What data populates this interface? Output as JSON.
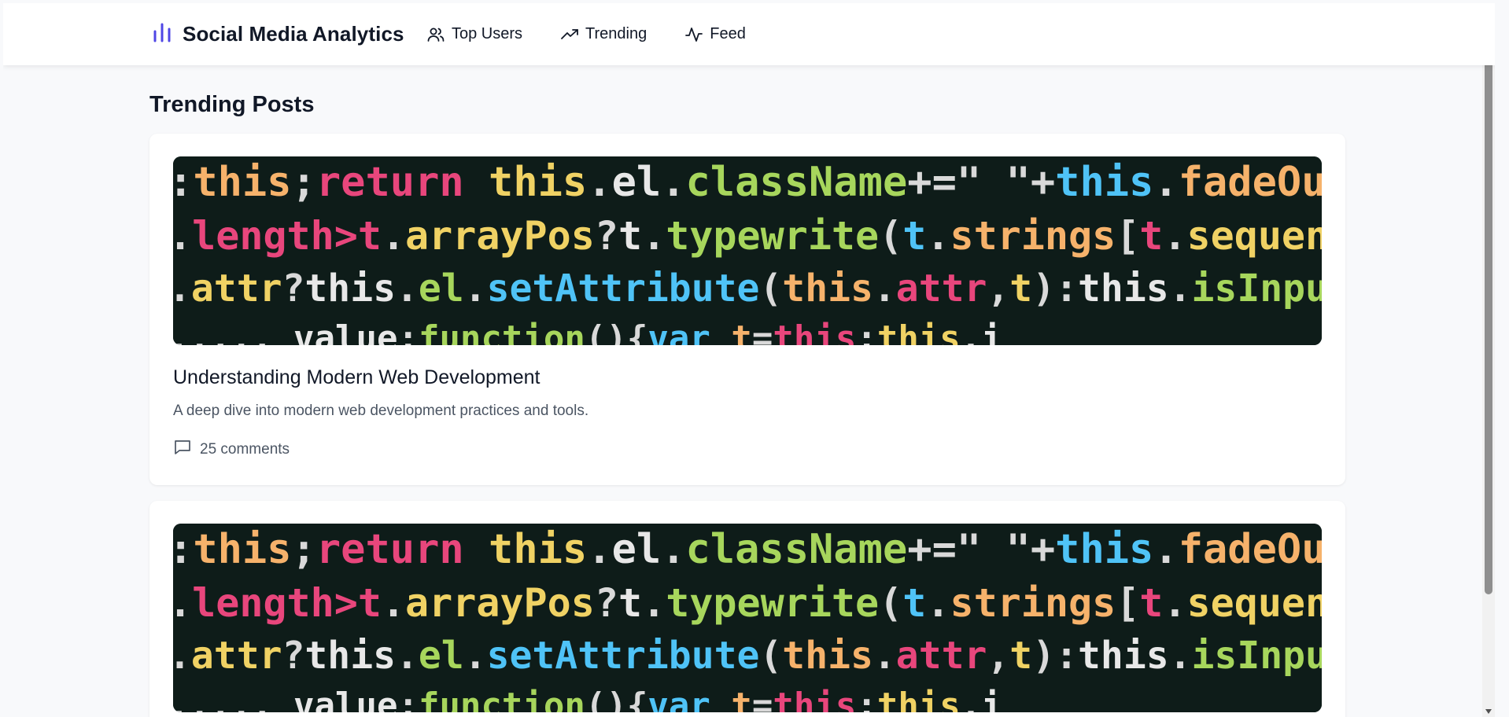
{
  "app": {
    "title": "Social Media Analytics",
    "accent_color": "#4f46e5"
  },
  "nav": {
    "items": [
      {
        "label": "Top Users",
        "icon": "users-icon"
      },
      {
        "label": "Trending",
        "icon": "trending-up-icon"
      },
      {
        "label": "Feed",
        "icon": "activity-icon"
      }
    ]
  },
  "page": {
    "title": "Trending Posts"
  },
  "posts": [
    {
      "title": "Understanding Modern Web Development",
      "description": "A deep dive into modern web development practices and tools.",
      "comments": "25 comments",
      "image": "code-screenshot"
    },
    {
      "image": "code-screenshot"
    }
  ],
  "code_image": {
    "lines": [
      ":this;return this.el.className+=\" \"+this.fadeOutClass,this.c",
      ".length>t.arrayPos?t.typewrite(t.strings[t.sequence[t.arrayP",
      ".attr?this.el.setAttribute(this.attr,t):this.isInput?this.el",
      "..... value:function(){var t=this;this.i"
    ]
  }
}
